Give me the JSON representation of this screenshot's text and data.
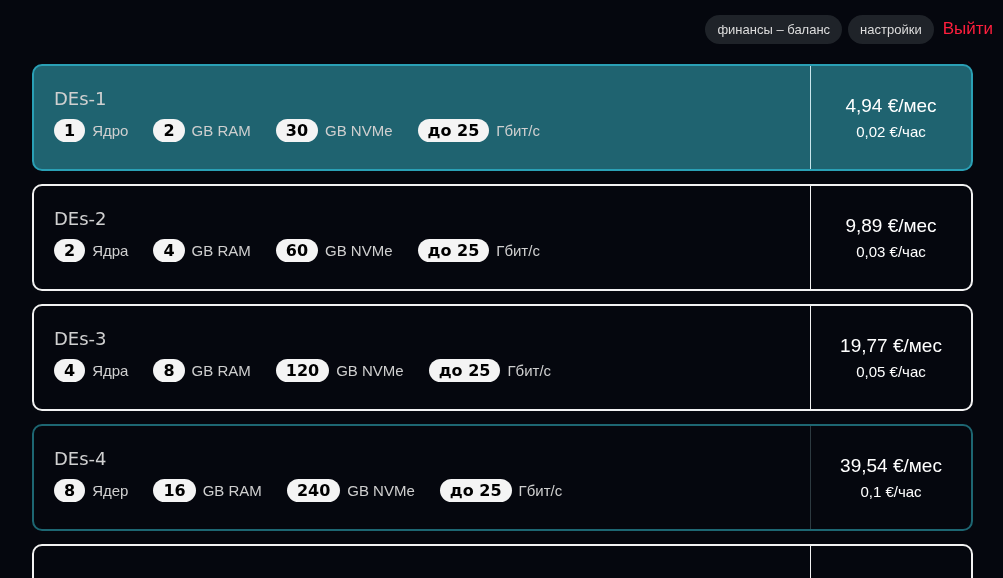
{
  "nav": [
    {
      "label": "финансы – баланс",
      "kind": "pill"
    },
    {
      "label": "настройки",
      "kind": "pill"
    },
    {
      "label": "Выйти",
      "kind": "logout"
    }
  ],
  "plans": [
    {
      "name": "DEs-1",
      "selected": true,
      "highlighted": false,
      "specs": [
        {
          "value": "1",
          "unit": "Ядро"
        },
        {
          "value": "2",
          "unit": "GB RAM"
        },
        {
          "value": "30",
          "unit": "GB NVMe"
        },
        {
          "value": "до 25",
          "unit": "Гбит/с"
        }
      ],
      "price_month": "4,94 €/мес",
      "price_hour": "0,02 €/час"
    },
    {
      "name": "DEs-2",
      "selected": false,
      "highlighted": false,
      "specs": [
        {
          "value": "2",
          "unit": "Ядра"
        },
        {
          "value": "4",
          "unit": "GB RAM"
        },
        {
          "value": "60",
          "unit": "GB NVMe"
        },
        {
          "value": "до 25",
          "unit": "Гбит/с"
        }
      ],
      "price_month": "9,89 €/мес",
      "price_hour": "0,03 €/час"
    },
    {
      "name": "DEs-3",
      "selected": false,
      "highlighted": false,
      "specs": [
        {
          "value": "4",
          "unit": "Ядра"
        },
        {
          "value": "8",
          "unit": "GB RAM"
        },
        {
          "value": "120",
          "unit": "GB NVMe"
        },
        {
          "value": "до 25",
          "unit": "Гбит/с"
        }
      ],
      "price_month": "19,77 €/мес",
      "price_hour": "0,05 €/час"
    },
    {
      "name": "DEs-4",
      "selected": false,
      "highlighted": true,
      "specs": [
        {
          "value": "8",
          "unit": "Ядер"
        },
        {
          "value": "16",
          "unit": "GB RAM"
        },
        {
          "value": "240",
          "unit": "GB NVMe"
        },
        {
          "value": "до 25",
          "unit": "Гбит/с"
        }
      ],
      "price_month": "39,54 €/мес",
      "price_hour": "0,1 €/час"
    },
    {
      "selected": false,
      "highlighted": false
    }
  ]
}
